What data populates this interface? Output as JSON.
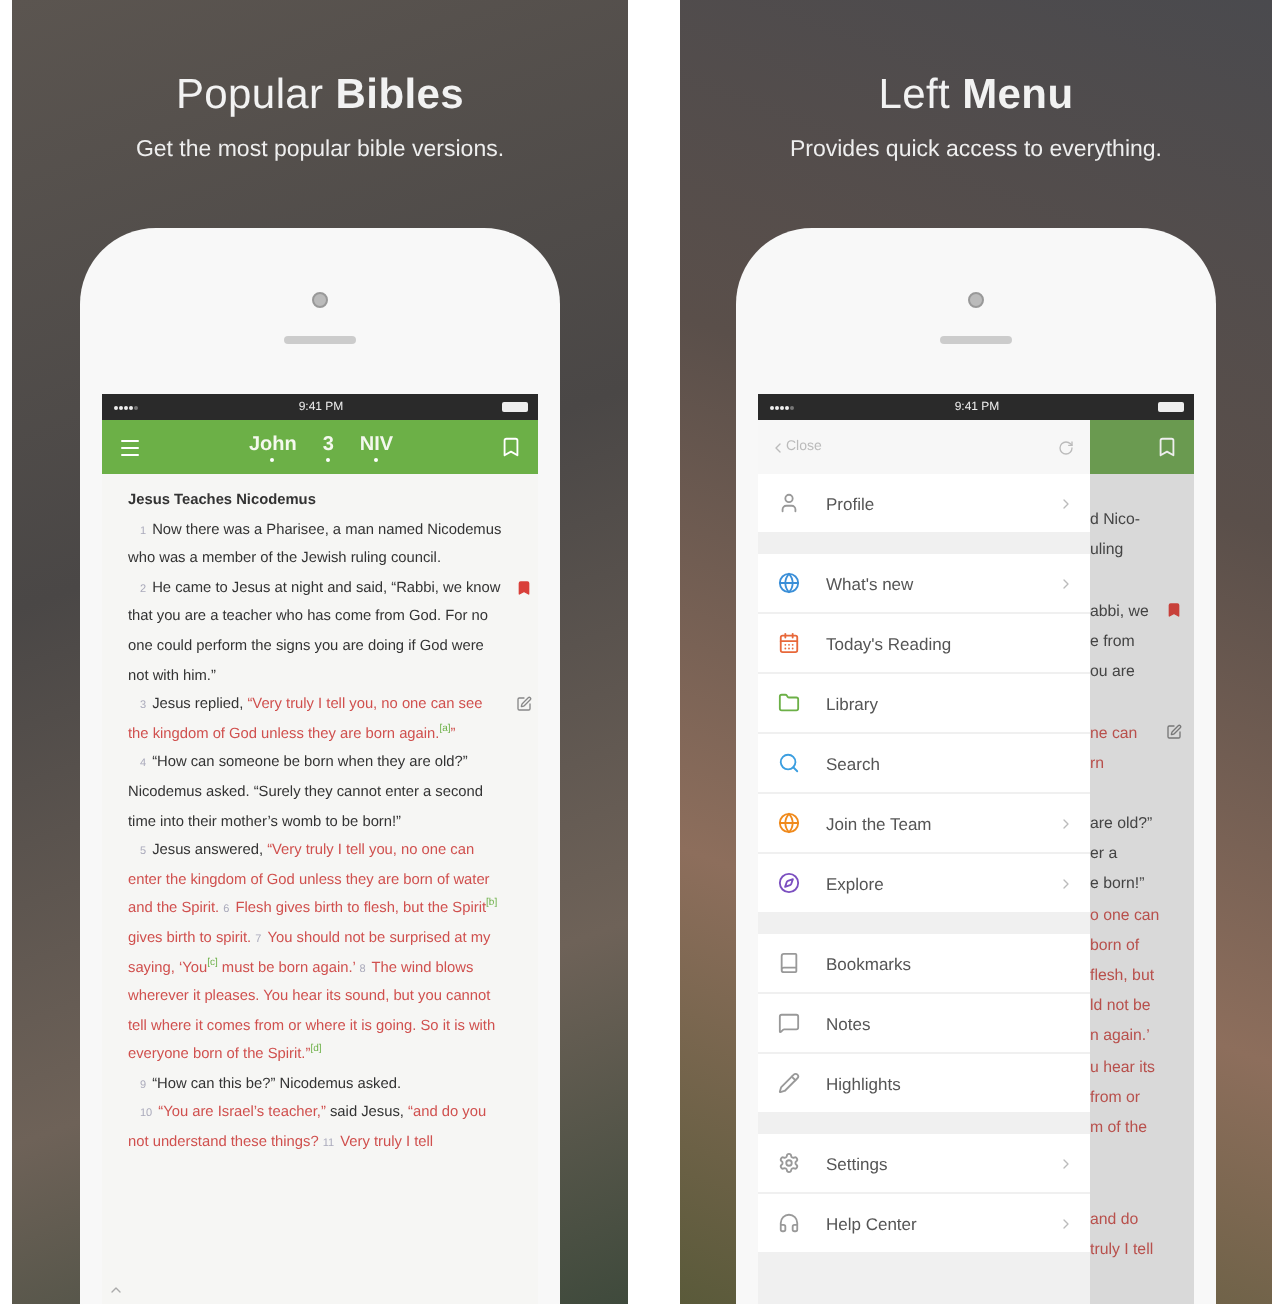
{
  "panels": [
    {
      "kind": "reader",
      "heading": "Popular **Bibles**",
      "subheading": "Get the most popular bible versions.",
      "status_time": "9:41 PM",
      "nav": {
        "book": "John",
        "chapter": "3",
        "version": "NIV"
      },
      "passage": {
        "title": "Jesus Teaches Nicodemus",
        "paragraphs": [
          {
            "bookmarked": false,
            "has_note": false,
            "segments": [
              {
                "kind": "num",
                "text": "1"
              },
              {
                "kind": "text",
                "text": "Now there was a Pharisee, a man named Nicodemus who was a member of the Jewish ruling council."
              }
            ]
          },
          {
            "bookmarked": true,
            "has_note": false,
            "segments": [
              {
                "kind": "num",
                "text": "2"
              },
              {
                "kind": "text",
                "text": "He came to Jesus at night and said, “Rabbi, we know that you are a teacher who has come from God. For no one could perform the signs you are doing if God were not with him.”"
              }
            ]
          },
          {
            "bookmarked": false,
            "has_note": true,
            "segments": [
              {
                "kind": "num",
                "text": "3"
              },
              {
                "kind": "text",
                "text": "Jesus replied, "
              },
              {
                "kind": "quote",
                "text": "“Very truly I tell you, no one can see the kingdom of God unless they are born again."
              },
              {
                "kind": "note",
                "text": "[a]"
              },
              {
                "kind": "quote",
                "text": "”"
              }
            ]
          },
          {
            "bookmarked": false,
            "has_note": false,
            "segments": [
              {
                "kind": "num",
                "text": "4"
              },
              {
                "kind": "text",
                "text": "“How can someone be born when they are old?” Nicodemus asked. “Surely they cannot enter a second time into their mother’s womb to be born!”"
              }
            ]
          },
          {
            "bookmarked": false,
            "has_note": false,
            "segments": [
              {
                "kind": "num",
                "text": "5"
              },
              {
                "kind": "text",
                "text": "Jesus answered, "
              },
              {
                "kind": "quote",
                "text": "“Very truly I tell you, no one can enter the kingdom of God unless they are born of water and the Spirit. "
              },
              {
                "kind": "num",
                "text": "6"
              },
              {
                "kind": "quote",
                "text": "Flesh gives birth to flesh, but the Spirit"
              },
              {
                "kind": "note",
                "text": "[b]"
              },
              {
                "kind": "quote",
                "text": " gives birth to spirit. "
              },
              {
                "kind": "num",
                "text": "7"
              },
              {
                "kind": "quote",
                "text": "You should not be surprised at my saying, ‘You"
              },
              {
                "kind": "note",
                "text": "[c]"
              },
              {
                "kind": "quote",
                "text": " must be born again.’ "
              },
              {
                "kind": "num",
                "text": "8"
              },
              {
                "kind": "quote",
                "text": "The wind blows wherever it pleases. You hear its sound, but you cannot tell where it comes from or where it is going. So it is with everyone born of the Spirit.”"
              },
              {
                "kind": "note",
                "text": "[d]"
              }
            ]
          },
          {
            "bookmarked": false,
            "has_note": false,
            "segments": [
              {
                "kind": "num",
                "text": "9"
              },
              {
                "kind": "text",
                "text": "“How can this be?” Nicodemus asked."
              }
            ]
          },
          {
            "bookmarked": false,
            "has_note": false,
            "segments": [
              {
                "kind": "num",
                "text": "10"
              },
              {
                "kind": "quote",
                "text": "“You are Israel’s teacher,”"
              },
              {
                "kind": "text",
                "text": " said Jesus, "
              },
              {
                "kind": "quote",
                "text": "“and do you not understand these things? "
              },
              {
                "kind": "num",
                "text": "11"
              },
              {
                "kind": "quote",
                "text": "Very truly I tell"
              }
            ]
          }
        ]
      }
    },
    {
      "kind": "menu",
      "heading": "Left **Menu**",
      "subheading": "Provides quick access to everything.",
      "status_time": "9:41 PM",
      "menu": {
        "close": "Close",
        "sections": [
          [
            {
              "label": "Profile",
              "chevron": true
            }
          ],
          [
            {
              "label": "What's new",
              "chevron": true
            },
            {
              "label": "Today's Reading",
              "chevron": false
            },
            {
              "label": "Library",
              "chevron": false
            },
            {
              "label": "Search",
              "chevron": false
            },
            {
              "label": "Join the Team",
              "chevron": true
            },
            {
              "label": "Explore",
              "chevron": true
            }
          ],
          [
            {
              "label": "Bookmarks",
              "chevron": false
            },
            {
              "label": "Notes",
              "chevron": false
            },
            {
              "label": "Highlights",
              "chevron": false
            }
          ],
          [
            {
              "label": "Settings",
              "chevron": true
            },
            {
              "label": "Help Center",
              "chevron": true
            }
          ]
        ]
      },
      "peek_lines": [
        {
          "kind": "blank"
        },
        {
          "kind": "line",
          "text": "d Nico-"
        },
        {
          "kind": "line",
          "text": "uling"
        },
        {
          "kind": "blank"
        },
        {
          "kind": "line",
          "text": "abbi, we",
          "bookmarked": true
        },
        {
          "kind": "line",
          "text": "e from"
        },
        {
          "kind": "line",
          "text": "ou are"
        },
        {
          "kind": "blank"
        },
        {
          "kind": "quote",
          "text": "ne can",
          "has_note": true
        },
        {
          "kind": "quote",
          "text": "rn"
        },
        {
          "kind": "blank"
        },
        {
          "kind": "line",
          "text": "are old?”"
        },
        {
          "kind": "line",
          "text": "er a"
        },
        {
          "kind": "line",
          "text": "e born!”"
        },
        {
          "kind": "quote",
          "text": "o one can"
        },
        {
          "kind": "quote",
          "text": "born of"
        },
        {
          "kind": "quote",
          "text": "flesh, but"
        },
        {
          "kind": "quote",
          "text": "ld not be"
        },
        {
          "kind": "quote",
          "text": "n again.’"
        },
        {
          "kind": "quote",
          "text": "u hear its"
        },
        {
          "kind": "quote",
          "text": "from or"
        },
        {
          "kind": "quote",
          "text": "m of the"
        },
        {
          "kind": "blank"
        },
        {
          "kind": "blank"
        },
        {
          "kind": "quote",
          "text": "and do"
        },
        {
          "kind": "quote",
          "text": "truly I tell"
        }
      ]
    }
  ]
}
